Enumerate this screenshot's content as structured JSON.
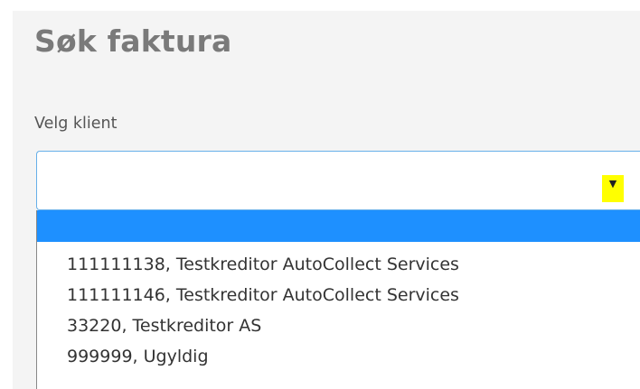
{
  "page": {
    "title": "Søk faktura"
  },
  "client_select": {
    "label": "Velg klient",
    "selected_value": "",
    "arrow_glyph": "▼",
    "arrow_icon": "triangle-down-icon",
    "arrow_highlight_color": "#ffff00",
    "focus_border_color": "#66afe9",
    "highlight_color": "#1e90ff",
    "options": [
      {
        "label": ""
      },
      {
        "label": "111111138, Testkreditor AutoCollect Services"
      },
      {
        "label": "111111146, Testkreditor AutoCollect Services"
      },
      {
        "label": "33220, Testkreditor AS"
      },
      {
        "label": "999999, Ugyldig"
      }
    ]
  }
}
